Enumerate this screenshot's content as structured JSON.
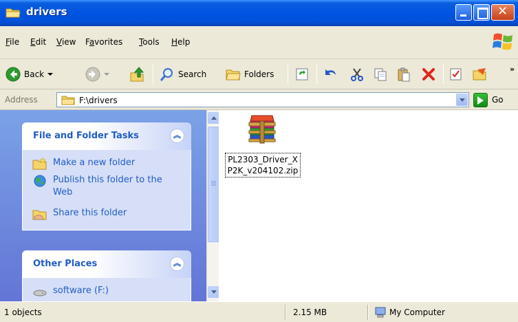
{
  "window": {
    "title": "drivers"
  },
  "menu": {
    "items": [
      {
        "label": "File",
        "accel": "F"
      },
      {
        "label": "Edit",
        "accel": "E"
      },
      {
        "label": "View",
        "accel": "V"
      },
      {
        "label": "Favorites",
        "accel": "a"
      },
      {
        "label": "Tools",
        "accel": "T"
      },
      {
        "label": "Help",
        "accel": "H"
      }
    ]
  },
  "toolbar": {
    "back_label": "Back",
    "search_label": "Search",
    "folders_label": "Folders"
  },
  "address": {
    "label": "Address",
    "value": "F:\\drivers",
    "go_label": "Go"
  },
  "tasks": {
    "file_folder_title": "File and Folder Tasks",
    "items": [
      {
        "label": "Make a new folder"
      },
      {
        "label": "Publish this folder to the Web"
      },
      {
        "label": "Share this folder"
      }
    ],
    "other_places_title": "Other Places",
    "other_places": [
      {
        "label": "software (F:)"
      }
    ]
  },
  "files": [
    {
      "name": "PL2303_Driver_XP2K_v204102.zip",
      "icon": "winrar-archive-icon"
    }
  ],
  "status": {
    "objects": "1 objects",
    "size": "2.15 MB",
    "location": "My Computer"
  },
  "colors": {
    "titlebar": "#0054e3",
    "taskpane": "#7ba2e7",
    "task_link": "#215dc6"
  }
}
